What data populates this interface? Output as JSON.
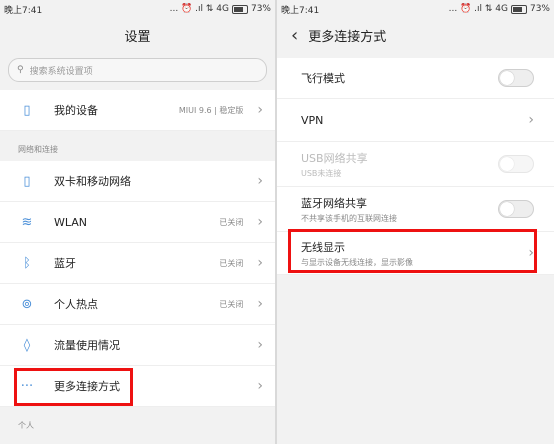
{
  "left": {
    "status": {
      "time": "晚上7:41",
      "icons": "... ⏰ .ıl ⇅ 4G",
      "battery": "73%"
    },
    "title": "设置",
    "search_placeholder": "搜索系统设置项",
    "device": {
      "label": "我的设备",
      "value": "MIUI 9.6 | 稳定版"
    },
    "section_network": "网络和连接",
    "network_items": [
      {
        "icon": "sim-icon",
        "glyph": "▯",
        "label": "双卡和移动网络",
        "value": ""
      },
      {
        "icon": "wifi-icon",
        "glyph": "≋",
        "label": "WLAN",
        "value": "已关闭"
      },
      {
        "icon": "bluetooth-icon",
        "glyph": "ᛒ",
        "label": "蓝牙",
        "value": "已关闭"
      },
      {
        "icon": "hotspot-icon",
        "glyph": "⊚",
        "label": "个人热点",
        "value": "已关闭"
      },
      {
        "icon": "data-usage-icon",
        "glyph": "◊",
        "label": "流量使用情况",
        "value": ""
      },
      {
        "icon": "more-icon",
        "glyph": "···",
        "label": "更多连接方式",
        "value": ""
      }
    ],
    "section_personal": "个人"
  },
  "right": {
    "status": {
      "time": "晚上7:41",
      "icons": "... ⏰ .ıl ⇅ 4G",
      "battery": "73%"
    },
    "title": "更多连接方式",
    "items": [
      {
        "label": "飞行模式",
        "sub": "",
        "control": "toggle",
        "enabled": true
      },
      {
        "label": "VPN",
        "sub": "",
        "control": "chevron",
        "enabled": true
      },
      {
        "label": "USB网络共享",
        "sub": "USB未连接",
        "control": "toggle",
        "enabled": false
      },
      {
        "label": "蓝牙网络共享",
        "sub": "不共享该手机的互联网连接",
        "control": "toggle",
        "enabled": true
      },
      {
        "label": "无线显示",
        "sub": "与显示设备无线连接，显示影像",
        "control": "chevron",
        "enabled": true
      }
    ]
  },
  "colors": {
    "highlight": "#e11111",
    "icon": "#4a8fd8"
  }
}
